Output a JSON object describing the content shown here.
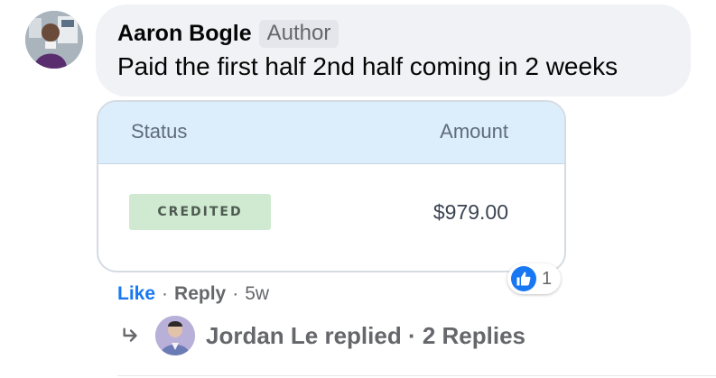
{
  "comment": {
    "author_name": "Aaron Bogle",
    "author_badge": "Author",
    "text": "Paid the first half 2nd half coming in 2 weeks",
    "avatar_icon": "user-avatar-photo"
  },
  "attachment": {
    "headers": {
      "status": "Status",
      "amount": "Amount"
    },
    "row": {
      "status": "CREDITED",
      "amount": "$979.00"
    },
    "colors": {
      "header_bg": "#dceefb",
      "badge_bg": "#cfead0"
    }
  },
  "reactions": {
    "icon": "thumbs-up-icon",
    "count": "1",
    "color": "#1877f2"
  },
  "actions": {
    "like": "Like",
    "separator": "·",
    "reply": "Reply",
    "time": "5w"
  },
  "replies": {
    "arrow_icon": "reply-arrow-icon",
    "avatar_icon": "replier-avatar-photo",
    "text": "Jordan Le replied · 2 Replies"
  }
}
